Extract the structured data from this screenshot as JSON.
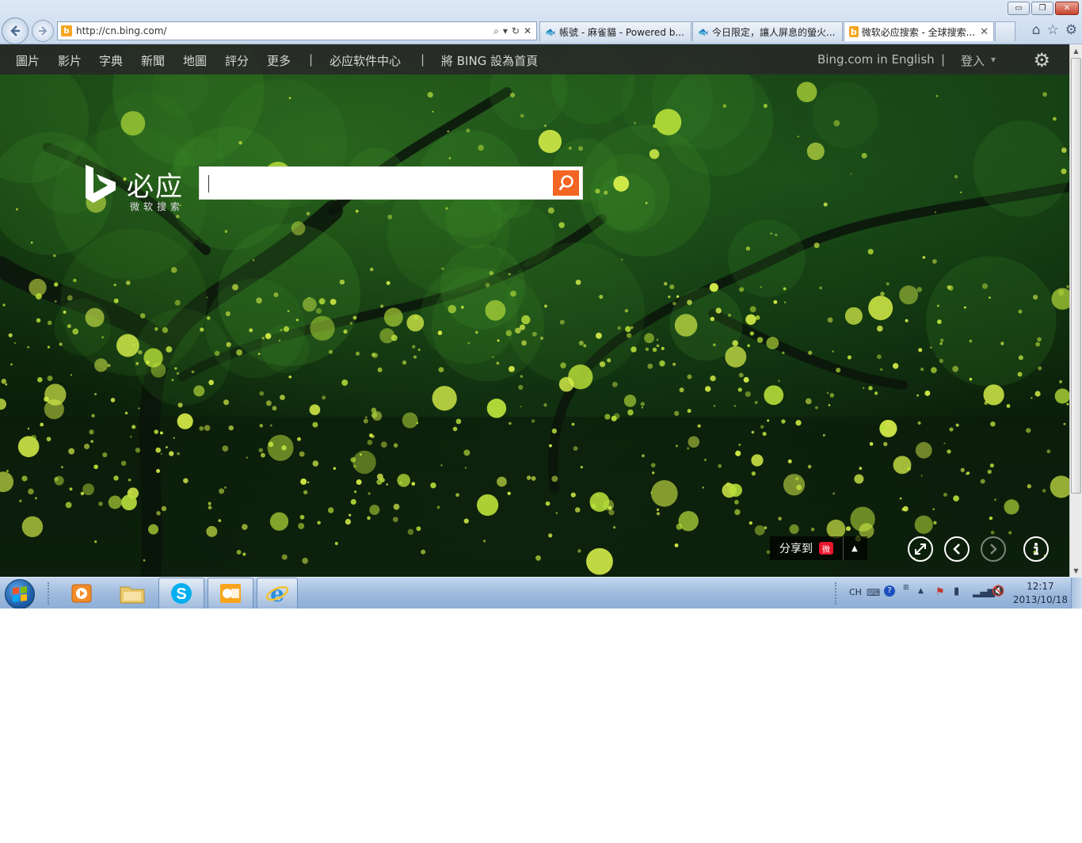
{
  "window": {
    "minimize_label": "▭",
    "restore_label": "❐",
    "close_label": "✕"
  },
  "browser": {
    "address": {
      "favicon": "b",
      "url": "http://cn.bing.com/"
    },
    "tabs": [
      {
        "icon": "fish-icon",
        "glyph": "🐟",
        "title": "帳號 - 麻雀貓 - Powered b..."
      },
      {
        "icon": "fish-icon",
        "glyph": "🐟",
        "title": "今日限定，讓人屏息的螢火..."
      },
      {
        "icon": "bing-icon",
        "glyph": "b",
        "title": "微软必应搜索 - 全球搜索..."
      }
    ],
    "tab_close": "✕",
    "toolbar_icons": [
      "home-icon",
      "star-icon",
      "gear-icon"
    ]
  },
  "bing": {
    "nav": {
      "items": [
        "圖片",
        "影片",
        "字典",
        "新聞",
        "地圖",
        "評分",
        "更多"
      ],
      "sep": "|",
      "software_center": "必应软件中心",
      "set_home": "將 BING 設為首頁",
      "english": "Bing.com in English",
      "signin": "登入",
      "signin_arrow": "▾"
    },
    "logo": {
      "title": "必应",
      "subtitle": "微软搜索"
    },
    "search": {
      "value": "",
      "placeholder": ""
    },
    "share": {
      "label": "分享到",
      "weibo": "微",
      "arrow": "▲"
    },
    "controls": [
      "expand-icon",
      "prev-icon",
      "next-icon",
      "info-icon"
    ],
    "colors": {
      "search_btn": "#f26522",
      "nav_bg": "#282828"
    }
  },
  "taskbar": {
    "apps": [
      "media-player-icon",
      "explorer-icon",
      "skype-icon",
      "outlook-icon",
      "ie-icon"
    ],
    "tray": {
      "lang": "CH"
    },
    "clock": {
      "time": "12:17",
      "date": "2013/10/18"
    }
  }
}
